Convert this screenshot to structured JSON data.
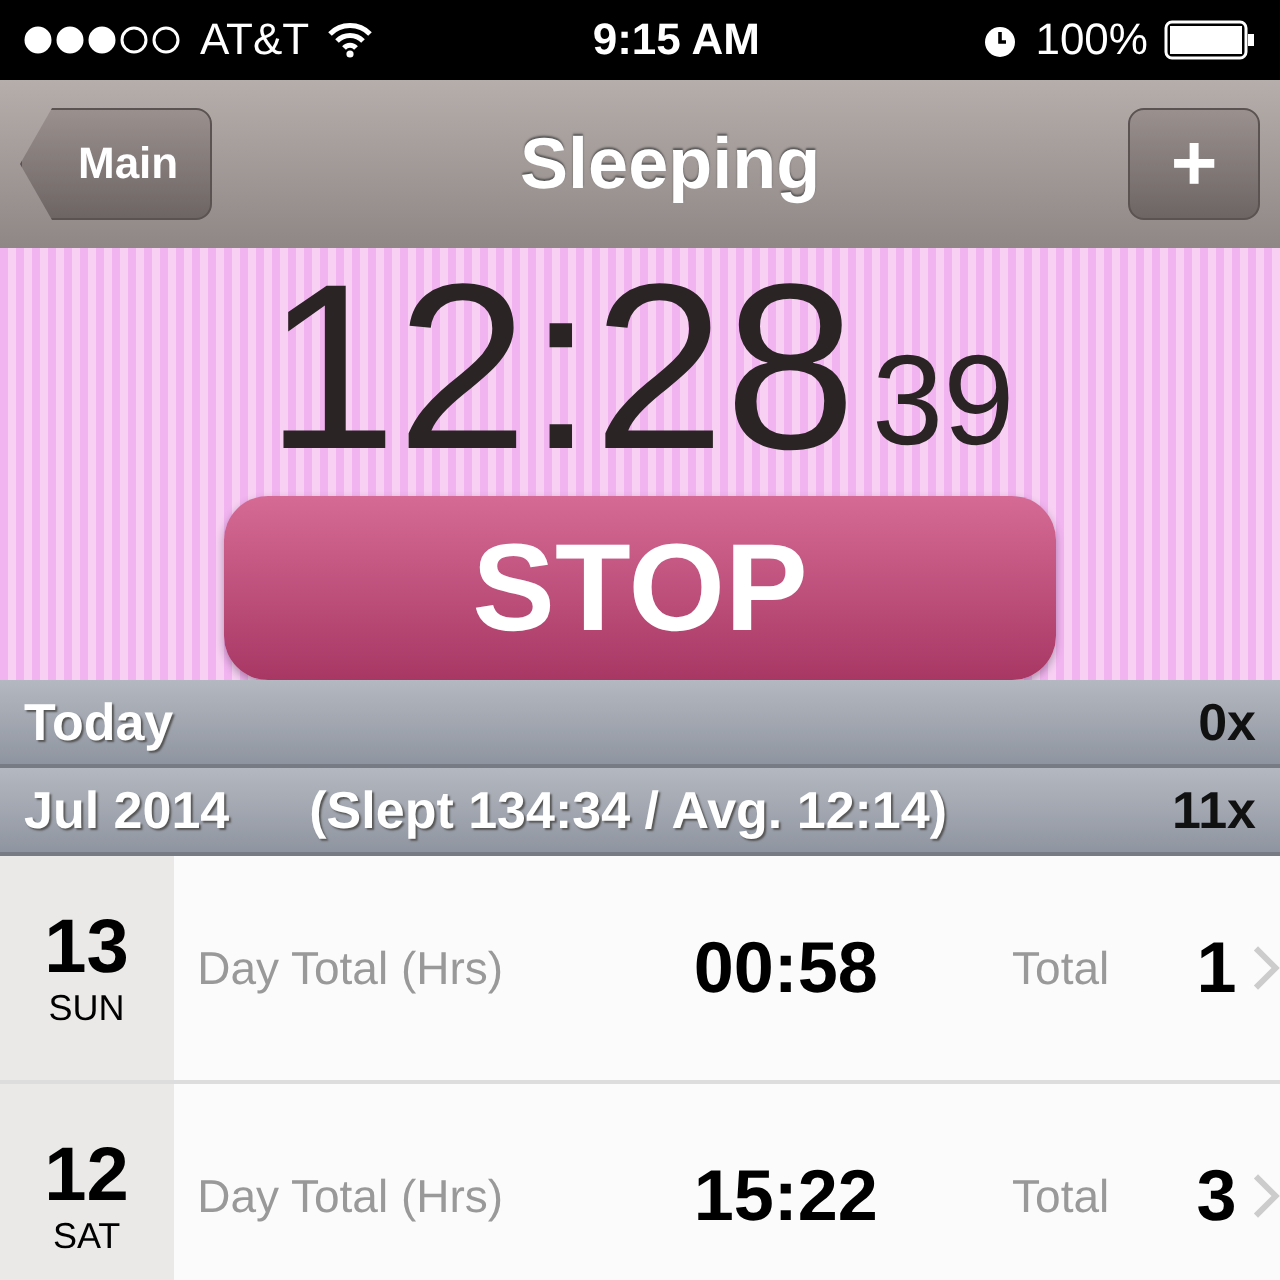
{
  "status_bar": {
    "carrier": "AT&T",
    "time": "9:15 AM",
    "battery": "100%"
  },
  "nav": {
    "back": "Main",
    "title": "Sleeping",
    "add": "+"
  },
  "timer": {
    "main": "12:28",
    "seconds": "39",
    "button": "STOP"
  },
  "sections": [
    {
      "label": "Today",
      "count": "0x"
    },
    {
      "label": "Jul 2014",
      "summary": "(Slept 134:34 / Avg. 12:14)",
      "count": "11x"
    }
  ],
  "rows": [
    {
      "day": "13",
      "weekday": "SUN",
      "label": "Day Total (Hrs)",
      "value": "00:58",
      "total_label": "Total",
      "total": "1"
    },
    {
      "day": "12",
      "weekday": "SAT",
      "label": "Day Total (Hrs)",
      "value": "15:22",
      "total_label": "Total",
      "total": "3"
    }
  ]
}
